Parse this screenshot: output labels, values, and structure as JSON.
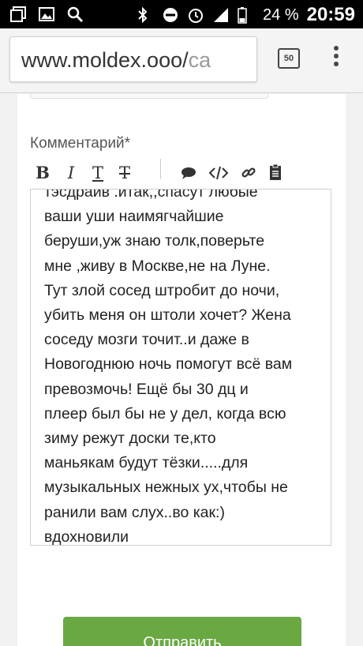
{
  "status_bar": {
    "battery_percent": "24 %",
    "time": "20:59",
    "icons": [
      "recent-apps-icon",
      "gallery-icon",
      "search-icon",
      "bluetooth-icon",
      "do-not-disturb-icon",
      "alarm-icon",
      "signal-icon",
      "battery-icon"
    ]
  },
  "browser": {
    "url_visible": "www.moldex.ooo/",
    "url_fade": "ca",
    "tab_count": "50"
  },
  "form": {
    "comment_label": "Комментарий*",
    "editor_toolbar": [
      {
        "name": "bold-button",
        "label": "B"
      },
      {
        "name": "italic-button",
        "label": "I"
      },
      {
        "name": "underline-button",
        "label": "T"
      },
      {
        "name": "strikethrough-button",
        "label": "T"
      }
    ],
    "comment_text": "тэсдрайв .итак,,спасут любые\nваши уши наимягчайшие\nберуши,уж знаю толк,поверьте\nмне ,живу в Москве,не на Луне.\nТут злой сосед штробит до ночи,\nубить меня он штоли хочет? Жена\nсоседу мозги точит..и даже в\nНовогоднюю ночь помогут всё вам\nпревозмочь! Ещё бы 30 дц и\nплеер был бы не у дел, когда всю\nзиму режут доски те,кто\nманьякам будут тёзки.....для\nмузыкальных нежных ух,чтобы не\nранили вам слух..во как:)\nвдохновили",
    "submit_label": "Отправить"
  },
  "colors": {
    "submit_button": "#6aa844",
    "status_bar": "#000000"
  }
}
